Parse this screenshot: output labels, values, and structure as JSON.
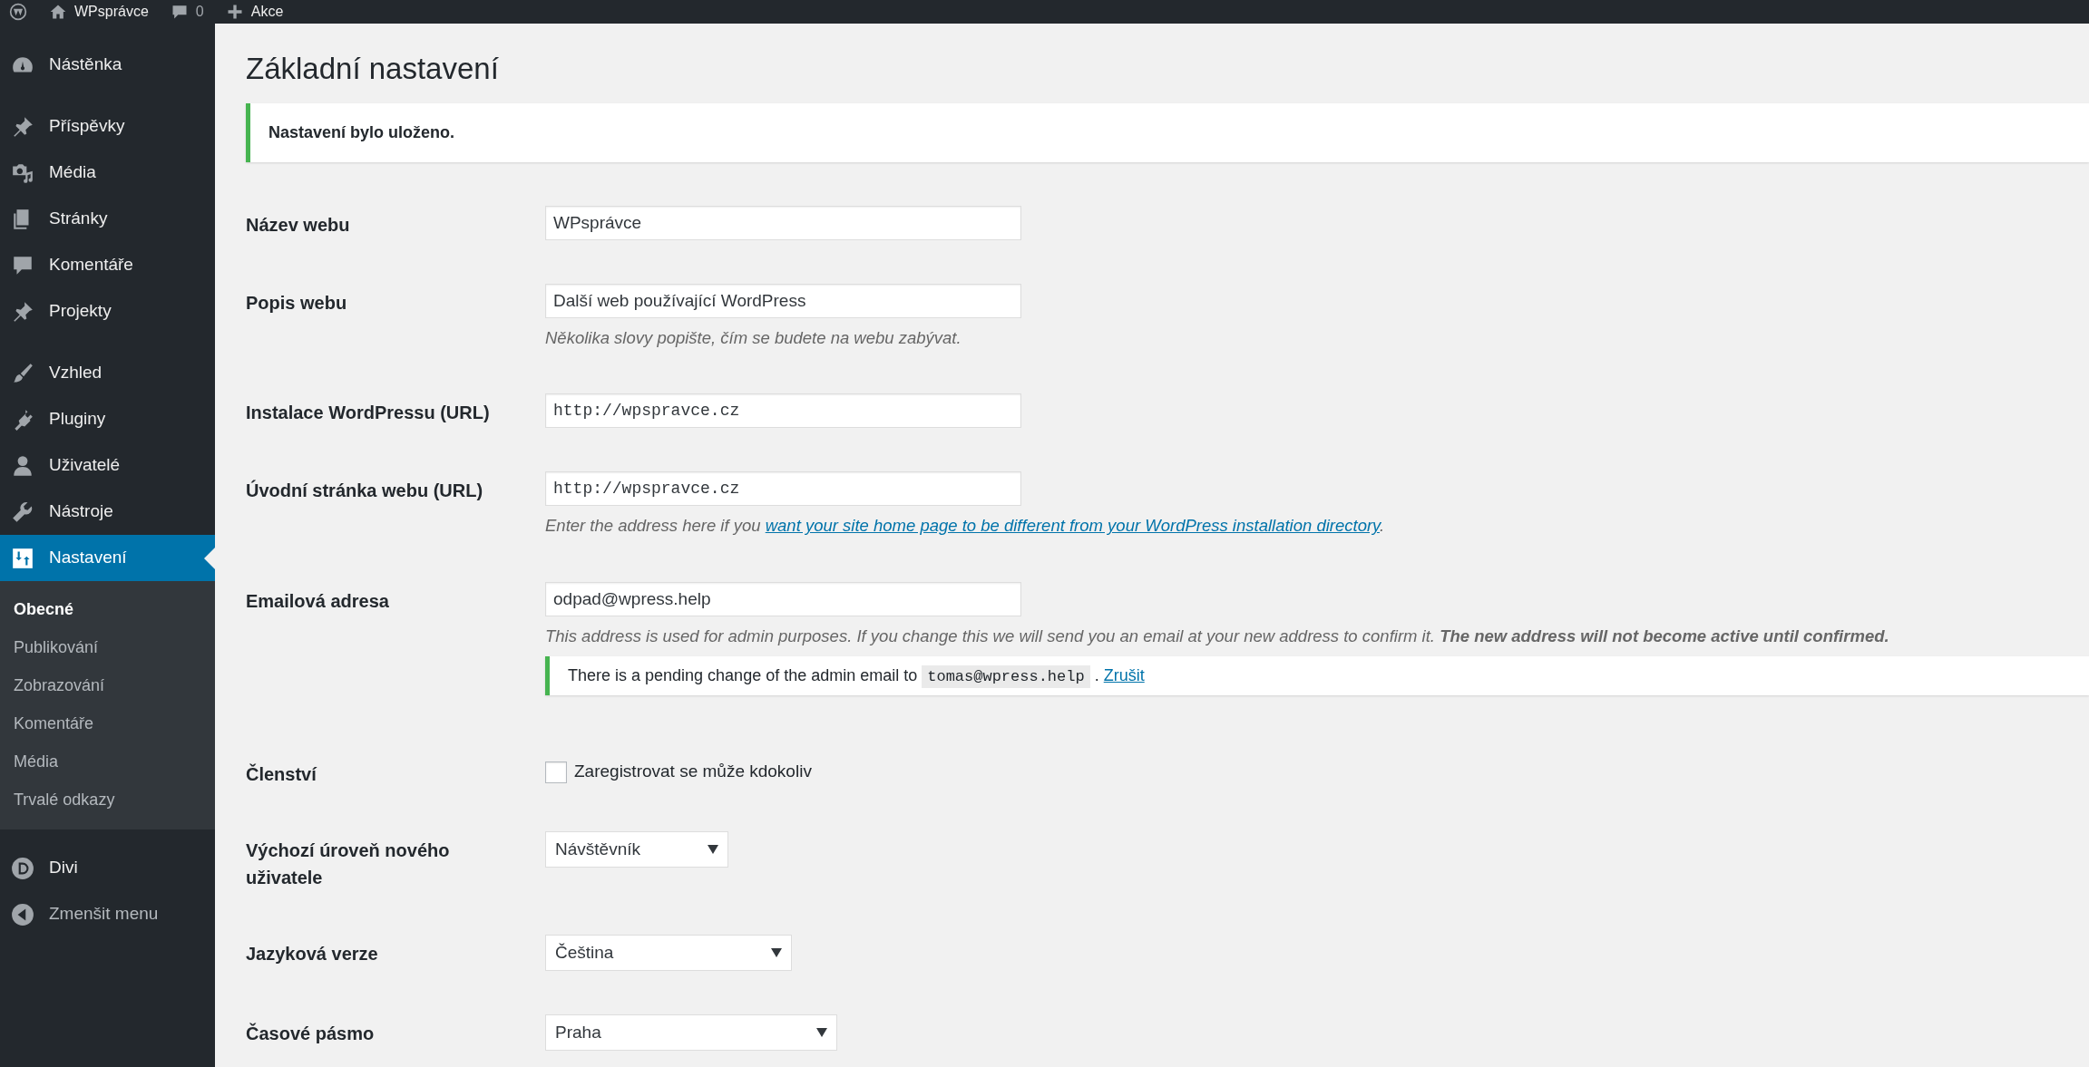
{
  "admin_bar": {
    "items": [
      {
        "kind": "logo"
      },
      {
        "kind": "home",
        "label": "WPsprávce"
      },
      {
        "kind": "comments",
        "label": "0"
      },
      {
        "kind": "new",
        "label": "Akce"
      }
    ]
  },
  "sidebar": {
    "groups": [
      {
        "items": [
          {
            "label": "Nástěnka",
            "selected": false
          }
        ]
      },
      {
        "items": [
          {
            "label": "Příspěvky",
            "selected": false
          },
          {
            "label": "Média",
            "selected": false
          },
          {
            "label": "Stránky",
            "selected": false
          },
          {
            "label": "Komentáře",
            "selected": false
          },
          {
            "label": "Projekty",
            "selected": false
          }
        ]
      },
      {
        "items": [
          {
            "label": "Vzhled",
            "selected": false
          },
          {
            "label": "Pluginy",
            "selected": false
          },
          {
            "label": "Uživatelé",
            "selected": false
          },
          {
            "label": "Nástroje",
            "selected": false
          },
          {
            "label": "Nastavení",
            "selected": true,
            "children": [
              {
                "label": "Obecné",
                "selected": true
              },
              {
                "label": "Publikování",
                "selected": false
              },
              {
                "label": "Zobrazování",
                "selected": false
              },
              {
                "label": "Komentáře",
                "selected": false
              },
              {
                "label": "Média",
                "selected": false
              },
              {
                "label": "Trvalé odkazy",
                "selected": false
              }
            ]
          },
          {
            "label": "Divi",
            "selected": false
          }
        ]
      }
    ],
    "collapse": {
      "label": "Zmenšit menu"
    }
  },
  "page": {
    "title": "Základní nastavení",
    "notice": {
      "text": "Nastavení bylo uloženo."
    },
    "fields": [
      {
        "kind": "text",
        "label": "Název webu",
        "value": "WPsprávce"
      },
      {
        "kind": "text",
        "label": "Popis webu",
        "value": "Další web používající WordPress",
        "description": {
          "text": "Několika slovy popište, čím se budete na webu zabývat."
        }
      },
      {
        "kind": "url",
        "label": "Instalace WordPressu (URL)",
        "value": "http://wpspravce.cz"
      },
      {
        "kind": "url",
        "label": "Úvodní stránka webu (URL)",
        "value": "http://wpspravce.cz",
        "description": {
          "text": "Enter the address here if you ",
          "link": "want your site home page to be different from your WordPress installation directory",
          "after": "."
        }
      },
      {
        "kind": "text",
        "label": "Emailová adresa",
        "value": "odpad@wpress.help",
        "description": {
          "text": "This address is used for admin purposes. If you change this we will send you an email at your new address to confirm it. **The new address will not become active until confirmed.**"
        },
        "pending": {
          "text": "There is a pending change of the admin email to",
          "code": "tomas@wpress.help",
          "after": ".",
          "link": "Zrušit"
        }
      },
      {
        "kind": "checkbox",
        "label": "Členství",
        "checked": false,
        "option": "Zaregistrovat se může kdokoliv"
      },
      {
        "kind": "select",
        "label": "Výchozí úroveň nového uživatele",
        "value": "Návštěvník"
      },
      {
        "kind": "select",
        "label": "Jazyková verze",
        "value": "Čeština"
      },
      {
        "kind": "select",
        "label": "Časové pásmo",
        "value": "Praha"
      }
    ]
  }
}
